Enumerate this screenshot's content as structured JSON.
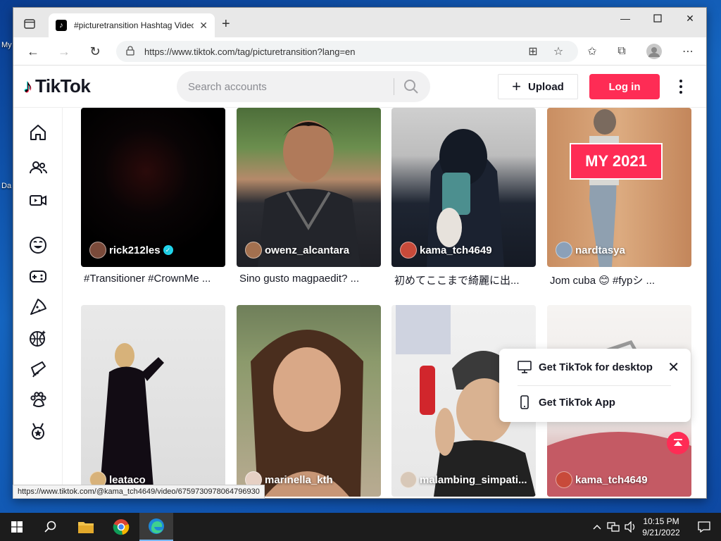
{
  "desktop": {
    "labels": [
      "My",
      "Da"
    ]
  },
  "browser": {
    "tab_title": "#picturetransition Hashtag Videos",
    "url": "https://www.tiktok.com/tag/picturetransition?lang=en",
    "status_url": "https://www.tiktok.com/@kama_tch4649/video/6759730978064796930"
  },
  "header": {
    "logo_text": "TikTok",
    "search_placeholder": "Search accounts",
    "upload_label": "Upload",
    "login_label": "Log in"
  },
  "sidebar": {
    "icons": [
      "home-icon",
      "following-icon",
      "live-icon",
      "comedy-icon",
      "gaming-icon",
      "food-icon",
      "sports-icon",
      "beauty-icon",
      "animals-icon",
      "achievement-icon"
    ]
  },
  "videos": [
    {
      "user": "rick212les",
      "verified": true,
      "caption": "#Transitioner #CrownMe ..."
    },
    {
      "user": "owenz_alcantara",
      "verified": false,
      "caption": "Sino gusto magpaedit? ..."
    },
    {
      "user": "kama_tch4649",
      "verified": false,
      "caption": "初めてここまで綺麗に出..."
    },
    {
      "user": "nardtasya",
      "verified": false,
      "caption": "Jom cuba 😊 #fypシ ...",
      "overlay": "MY 2021"
    },
    {
      "user": "leataco",
      "verified": false,
      "caption": ""
    },
    {
      "user": "marinella_kth",
      "verified": false,
      "caption": ""
    },
    {
      "user": "malambing_simpati...",
      "verified": false,
      "caption": ""
    },
    {
      "user": "kama_tch4649",
      "verified": false,
      "caption": ""
    }
  ],
  "popup": {
    "desktop_label": "Get TikTok for desktop",
    "app_label": "Get TikTok App"
  },
  "taskbar": {
    "time": "10:15 PM",
    "date": "9/21/2022"
  },
  "colors": {
    "brand": "#fe2c55",
    "accent_cyan": "#25f4ee"
  }
}
